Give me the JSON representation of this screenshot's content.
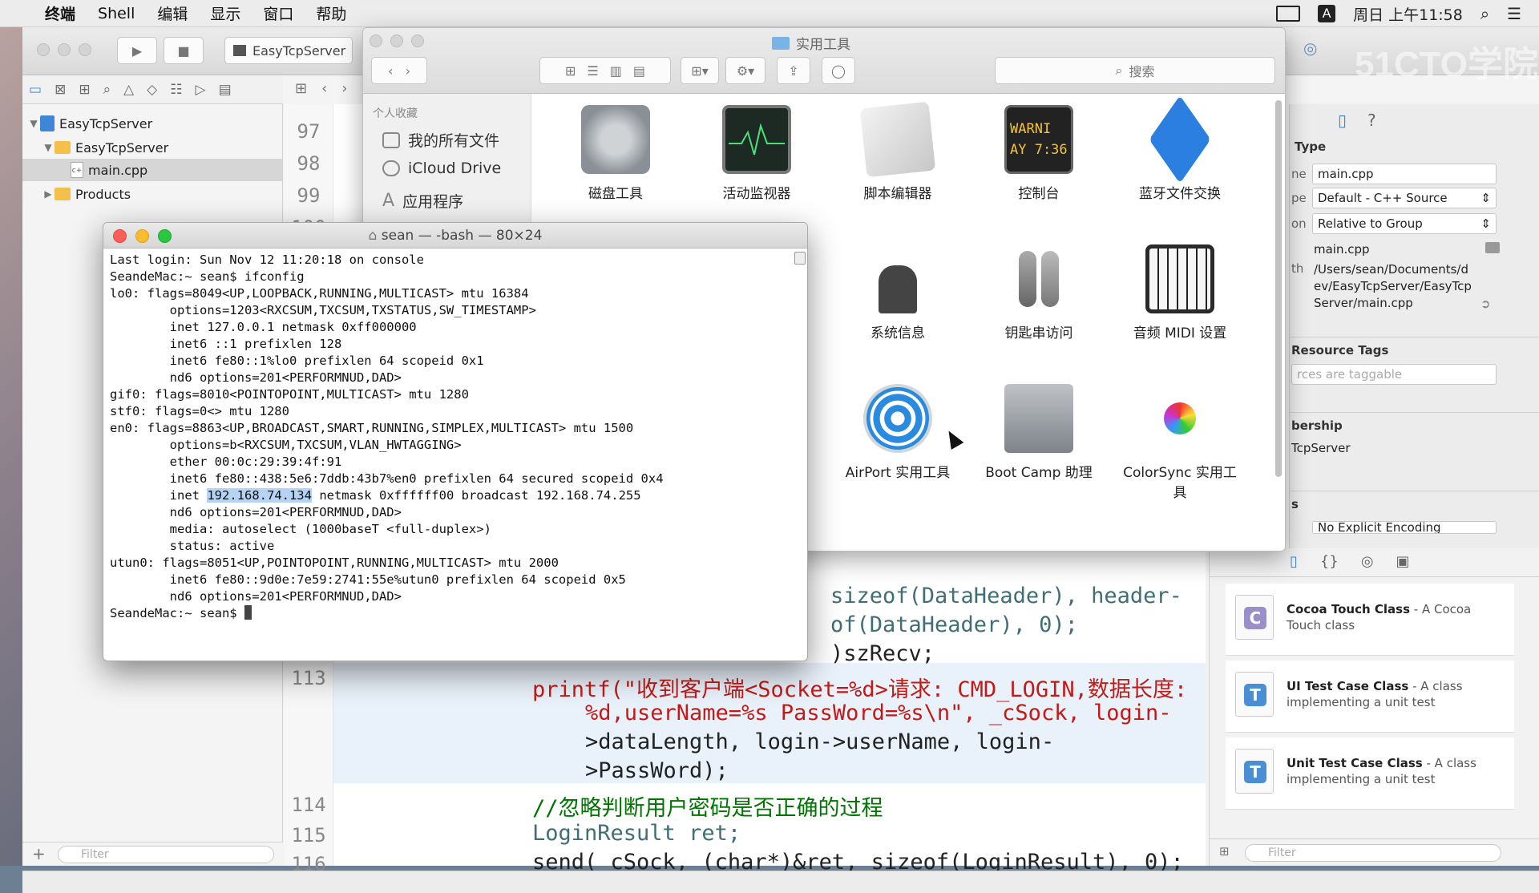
{
  "menubar": {
    "apple": "",
    "items": [
      "终端",
      "Shell",
      "编辑",
      "显示",
      "窗口",
      "帮助"
    ],
    "clock": "周日 上午11:58",
    "input_source": "A"
  },
  "xcode": {
    "scheme": "EasyTcpServer",
    "tree": [
      {
        "label": "EasyTcpServer",
        "kind": "project"
      },
      {
        "label": "EasyTcpServer",
        "kind": "folder"
      },
      {
        "label": "main.cpp",
        "kind": "file"
      },
      {
        "label": "Products",
        "kind": "folder"
      }
    ],
    "filter_placeholder": "Filter",
    "gutter_top": [
      "97",
      "98",
      "99",
      "100"
    ],
    "gutter_bottom": [
      "113",
      "114",
      "115",
      "116"
    ],
    "code_lines": [
      "sizeof(DataHeader), header-",
      "of(DataHeader), 0);",
      ")szRecv;",
      "printf(\"收到客户端<Socket=%d>请求: CMD_LOGIN,数据长度:",
      "%d,userName=%s PassWord=%s\\n\", _cSock, login-",
      ">dataLength, login->userName, login-",
      ">PassWord);",
      "//忽略判断用户密码是否正确的过程",
      "LoginResult ret;",
      "send(_cSock, (char*)&ret, sizeof(LoginResult), 0);"
    ],
    "inspector": {
      "section_type": "Type",
      "name_label": "ne",
      "name_value": "main.cpp",
      "type_label": "pe",
      "type_value": "Default - C++ Source",
      "location_label": "on",
      "location_value": "Relative to Group",
      "file_name": "main.cpp",
      "path_label": "th",
      "full_path": "/Users/sean/Documents/dev/EasyTcpServer/EasyTcpServer/main.cpp",
      "section_tags": "Resource Tags",
      "tags_placeholder": "rces are taggable",
      "section_membership": "bership",
      "membership_target": "TcpServer",
      "section_text": "s",
      "encoding_value": "No Explicit Encoding"
    },
    "library": [
      {
        "title": "Cocoa Touch Class",
        "desc": " - A Cocoa Touch class",
        "letter": "C",
        "color": "#9b8fc9"
      },
      {
        "title": "UI Test Case Class",
        "desc": " - A class implementing a unit test",
        "letter": "T",
        "color": "#4a8fd4"
      },
      {
        "title": "Unit Test Case Class",
        "desc": " - A class implementing a unit test",
        "letter": "T",
        "color": "#4a8fd4"
      }
    ],
    "library_filter": "Filter"
  },
  "finder": {
    "title": "实用工具",
    "search_placeholder": "搜索",
    "sidebar_header": "个人收藏",
    "sidebar": [
      "我的所有文件",
      "iCloud Drive",
      "应用程序"
    ],
    "apps": [
      {
        "label": "磁盘工具",
        "icon": "disk-utility-icon"
      },
      {
        "label": "活动监视器",
        "icon": "activity-monitor-icon"
      },
      {
        "label": "脚本编辑器",
        "icon": "script-editor-icon"
      },
      {
        "label": "控制台",
        "icon": "console-icon",
        "screen": "WARNI\nAY 7:36"
      },
      {
        "label": "蓝牙文件交换",
        "icon": "bluetooth-icon"
      },
      {
        "label": "系统信息",
        "icon": "system-info-icon"
      },
      {
        "label": "钥匙串访问",
        "icon": "keychain-icon"
      },
      {
        "label": "音频 MIDI 设置",
        "icon": "midi-icon"
      },
      {
        "label": "AirPort 实用工具",
        "icon": "airport-icon"
      },
      {
        "label": "Boot Camp 助理",
        "icon": "bootcamp-icon"
      },
      {
        "label": "ColorSync 实用工具",
        "icon": "colorsync-icon"
      }
    ]
  },
  "terminal": {
    "title": "sean — -bash — 80×24",
    "lines_before": "Last login: Sun Nov 12 11:20:18 on console\nSeandeMac:~ sean$ ifconfig\nlo0: flags=8049<UP,LOOPBACK,RUNNING,MULTICAST> mtu 16384\n        options=1203<RXCSUM,TXCSUM,TXSTATUS,SW_TIMESTAMP>\n        inet 127.0.0.1 netmask 0xff000000\n        inet6 ::1 prefixlen 128\n        inet6 fe80::1%lo0 prefixlen 64 scopeid 0x1\n        nd6 options=201<PERFORMNUD,DAD>\ngif0: flags=8010<POINTOPOINT,MULTICAST> mtu 1280\nstf0: flags=0<> mtu 1280\nen0: flags=8863<UP,BROADCAST,SMART,RUNNING,SIMPLEX,MULTICAST> mtu 1500\n        options=b<RXCSUM,TXCSUM,VLAN_HWTAGGING>\n        ether 00:0c:29:39:4f:91\n        inet6 fe80::438:5e6:7ddb:43b7%en0 prefixlen 64 secured scopeid 0x4\n        inet ",
    "selected_ip": "192.168.74.134",
    "lines_after": " netmask 0xffffff00 broadcast 192.168.74.255\n        nd6 options=201<PERFORMNUD,DAD>\n        media: autoselect (1000baseT <full-duplex>)\n        status: active\nutun0: flags=8051<UP,POINTOPOINT,RUNNING,MULTICAST> mtu 2000\n        inet6 fe80::9d0e:7e59:2741:55e%utun0 prefixlen 64 scopeid 0x5\n        nd6 options=201<PERFORMNUD,DAD>\nSeandeMac:~ sean$ "
  },
  "watermark": "51CTO学院"
}
